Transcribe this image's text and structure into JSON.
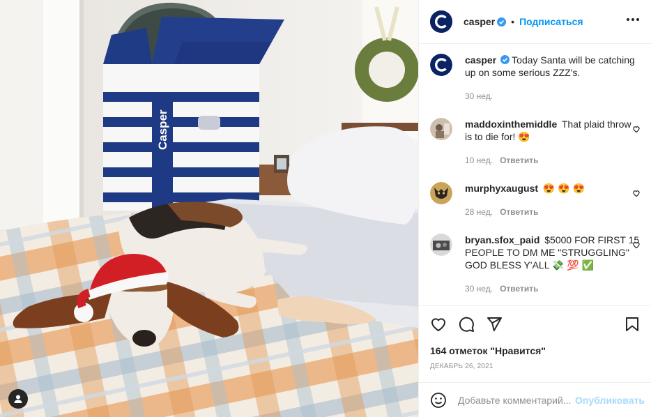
{
  "post": {
    "author": "casper",
    "follow_label": "Подписаться",
    "separator": "•",
    "caption": "Today Santa will be catching up on some serious ZZZ's.",
    "caption_time": "30 нед."
  },
  "brand": {
    "logo_text": "C",
    "box_text": "Casper",
    "primary_color": "#0b2264",
    "link_color": "#0095f6"
  },
  "comments": [
    {
      "user": "maddoxinthemiddle",
      "text": "That plaid throw is to die for! 😍",
      "time": "10 нед.",
      "reply_label": "Ответить"
    },
    {
      "user": "murphyxaugust",
      "text": "😍 😍 😍",
      "time": "28 нед.",
      "reply_label": "Ответить"
    },
    {
      "user": "bryan.sfox_paid",
      "text": "$5000 FOR FIRST 15 PEOPLE TO DM ME \"STRUGGLING\" GOD BLESS Y'ALL 💸 💯 ✅",
      "time": "30 нед.",
      "reply_label": "Ответить"
    }
  ],
  "likes": "164 отметок \"Нравится\"",
  "date": "ДЕКАБРЬ 26, 2021",
  "add_comment": {
    "placeholder": "Добавьте комментарий...",
    "publish_label": "Опубликовать"
  },
  "icons": [
    "heart-icon",
    "comment-icon",
    "share-icon",
    "bookmark-icon",
    "emoji-icon",
    "more-icon",
    "verified-icon",
    "user-tag-icon"
  ]
}
